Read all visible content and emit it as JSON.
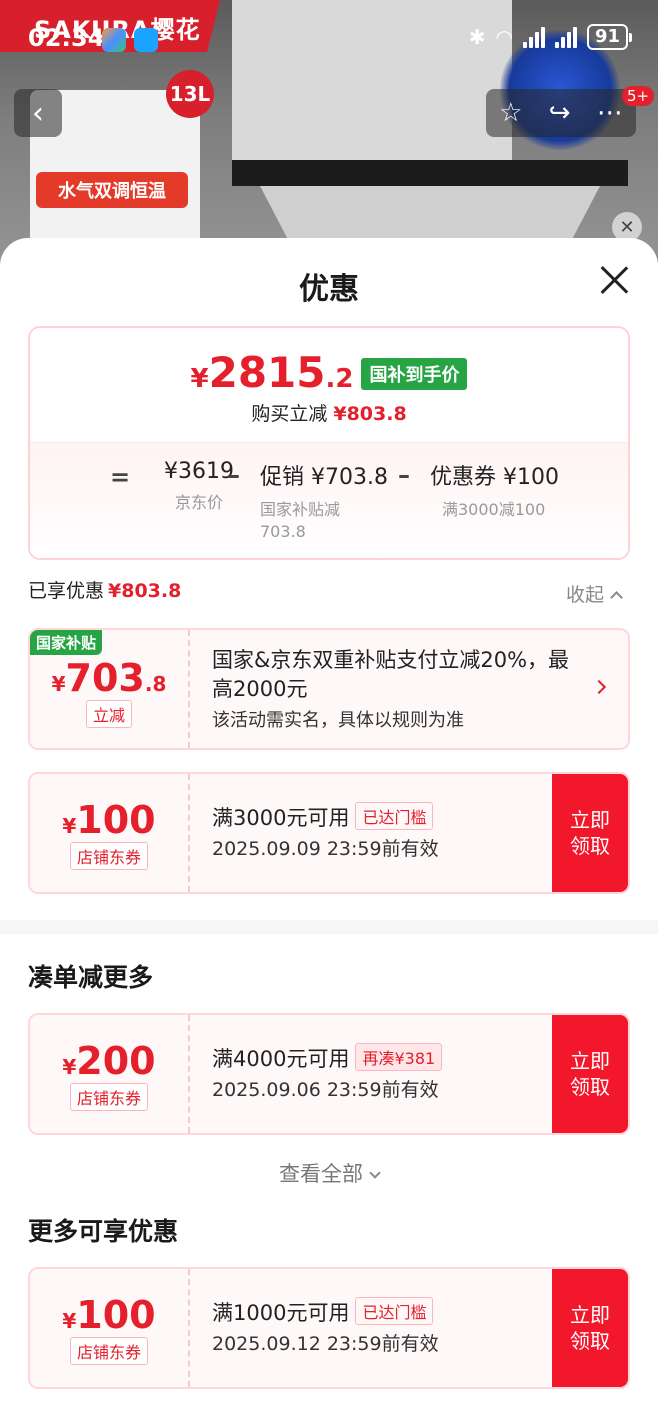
{
  "status_bar": {
    "time": "02:34",
    "battery": "91"
  },
  "background": {
    "brand": "SAKURA樱花",
    "capacity": "13L",
    "feature": "水气双调恒温",
    "badge_count": "5+",
    "accent": "#e4202c"
  },
  "sheet": {
    "title": "优惠"
  },
  "summary": {
    "currency": "¥",
    "final_int": "2815",
    "final_dec": ".2",
    "final_tag": "国补到手价",
    "reduce_label": "购买立减",
    "reduce_value": "¥803.8",
    "eq": "=",
    "minus": "–",
    "components": [
      {
        "value": "¥3619",
        "sub": "京东价"
      },
      {
        "value": "促销 ¥703.8",
        "sub": "国家补贴减 703.8"
      },
      {
        "value": "优惠券 ¥100",
        "sub": "满3000减100"
      }
    ]
  },
  "enjoyed": {
    "label": "已享优惠",
    "value": "¥803.8",
    "collapse": "收起"
  },
  "subsidy": {
    "tag": "国家补贴",
    "currency": "¥",
    "int": "703",
    "dec": ".8",
    "sub_tag": "立减",
    "title": "国家&京东双重补贴支付立减20%，最高2000元",
    "note": "该活动需实名，具体以规则为准"
  },
  "coupons": [
    {
      "currency": "¥",
      "amount": "100",
      "type": "店铺东券",
      "condition": "满3000元可用",
      "status": "已达门槛",
      "date": "2025.09.09 23:59前有效",
      "claim": "立即领取"
    },
    {
      "currency": "¥",
      "amount": "200",
      "type": "店铺东券",
      "condition": "满4000元可用",
      "status": "再凑¥381",
      "date": "2025.09.06 23:59前有效",
      "claim": "立即领取"
    },
    {
      "currency": "¥",
      "amount": "100",
      "type": "店铺东券",
      "condition": "满1000元可用",
      "status": "已达门槛",
      "date": "2025.09.12 23:59前有效",
      "claim": "立即领取"
    }
  ],
  "sections": {
    "more_discount": "凑单减更多",
    "view_all": "查看全部",
    "more_available": "更多可享优惠"
  },
  "colors": {
    "red": "#e4202c",
    "green": "#27a545",
    "claim": "#f3172c"
  }
}
